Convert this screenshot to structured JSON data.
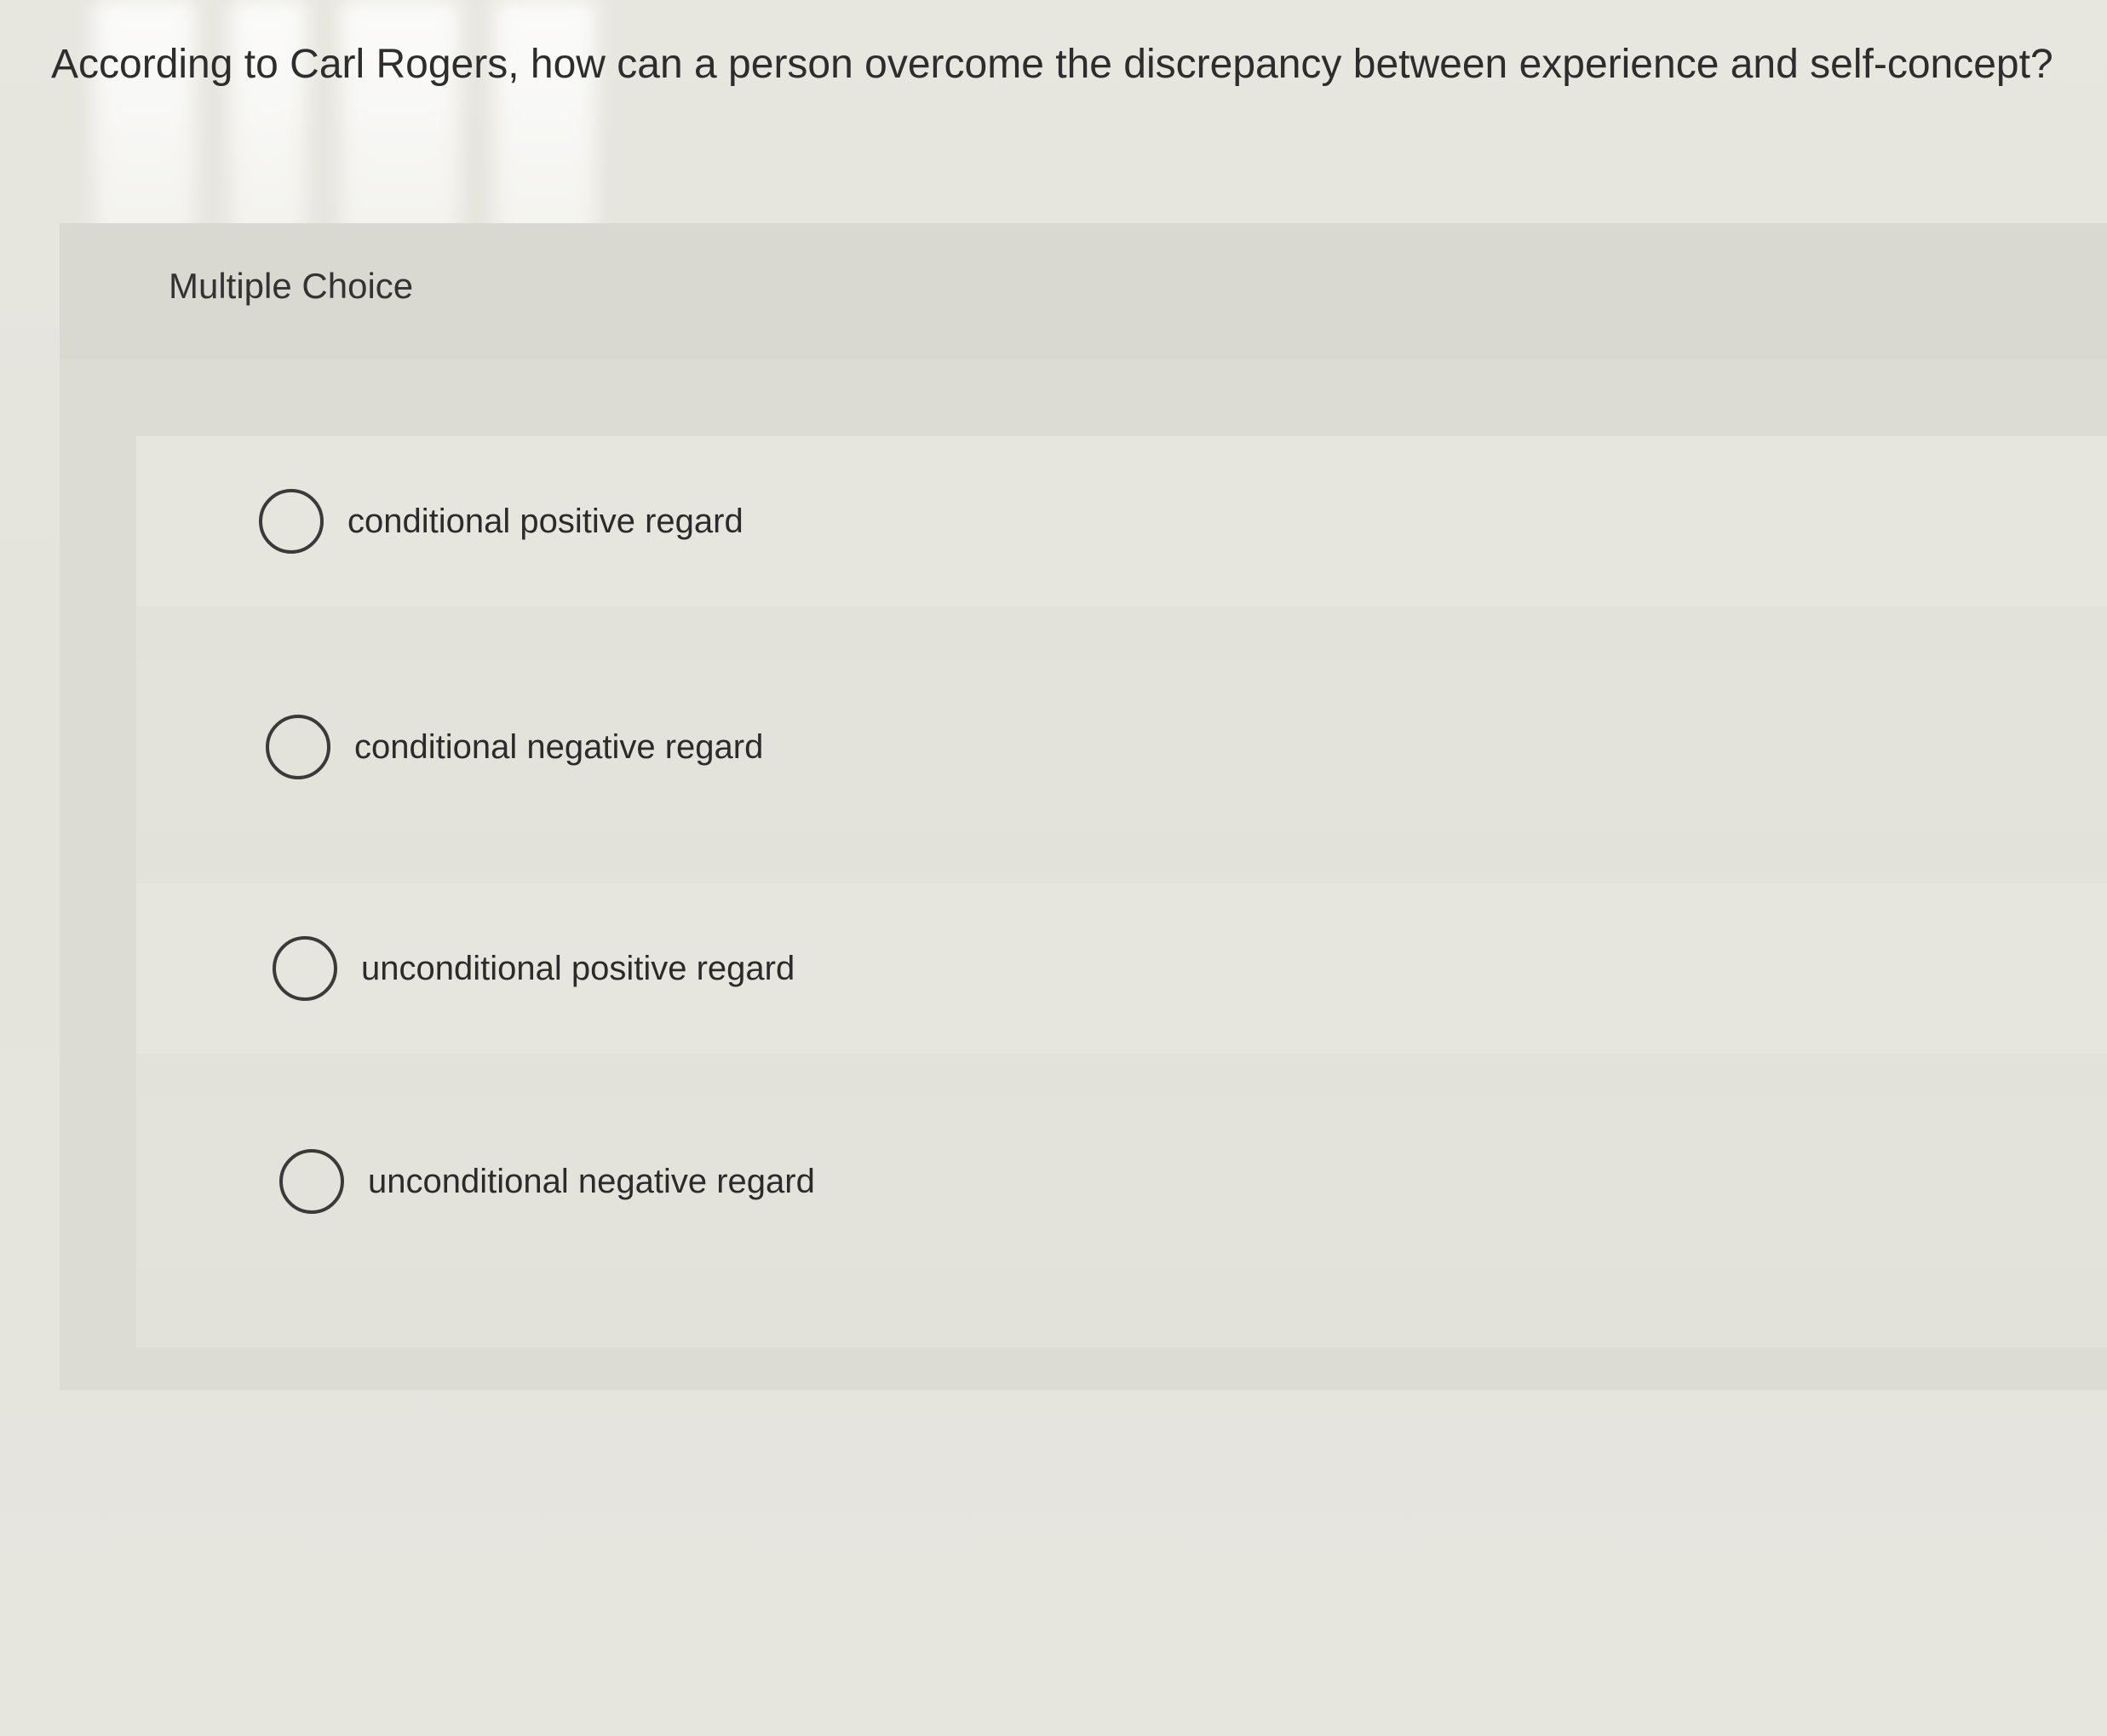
{
  "question": {
    "text": "According to Carl Rogers, how can a person overcome the discrepancy between experience and self-concept?"
  },
  "panel": {
    "type_label": "Multiple Choice"
  },
  "options": [
    {
      "label": "conditional positive regard",
      "selected": false
    },
    {
      "label": "conditional negative regard",
      "selected": false
    },
    {
      "label": "unconditional positive regard",
      "selected": false
    },
    {
      "label": "unconditional negative regard",
      "selected": false
    }
  ]
}
